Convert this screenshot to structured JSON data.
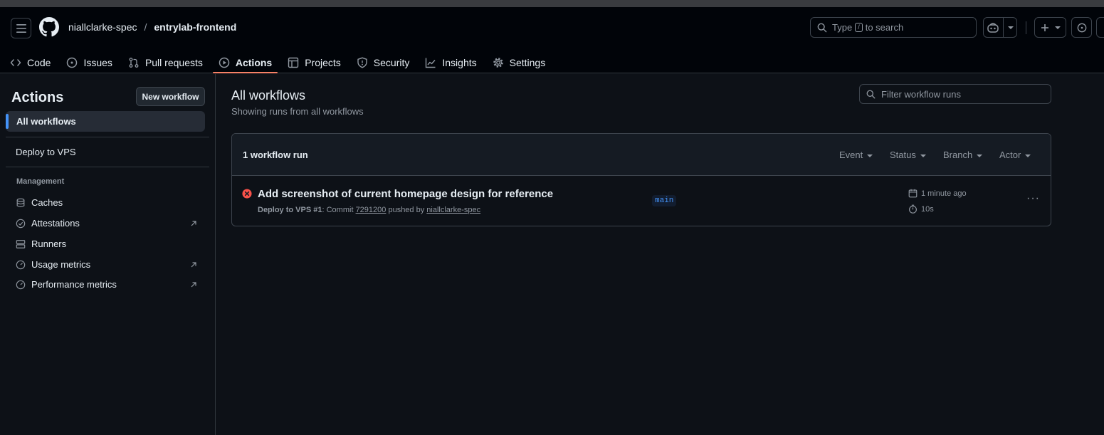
{
  "repo": {
    "owner": "niallclarke-spec",
    "separator": "/",
    "name": "entrylab-frontend"
  },
  "search": {
    "prefix": "Type",
    "key": "/",
    "suffix": "to search"
  },
  "nav": [
    {
      "label": "Code",
      "icon": "code-icon"
    },
    {
      "label": "Issues",
      "icon": "issue-icon"
    },
    {
      "label": "Pull requests",
      "icon": "pull-request-icon"
    },
    {
      "label": "Actions",
      "icon": "play-icon",
      "active": true
    },
    {
      "label": "Projects",
      "icon": "table-icon"
    },
    {
      "label": "Security",
      "icon": "shield-icon"
    },
    {
      "label": "Insights",
      "icon": "graph-icon"
    },
    {
      "label": "Settings",
      "icon": "gear-icon"
    }
  ],
  "sidebar": {
    "title": "Actions",
    "new_workflow": "New workflow",
    "all_workflows": "All workflows",
    "workflows": [
      "Deploy to VPS"
    ],
    "management_heading": "Management",
    "management": [
      {
        "label": "Caches",
        "icon": "database-icon",
        "external": false
      },
      {
        "label": "Attestations",
        "icon": "check-circle-icon",
        "external": true
      },
      {
        "label": "Runners",
        "icon": "server-icon",
        "external": false
      },
      {
        "label": "Usage metrics",
        "icon": "meter-icon",
        "external": true
      },
      {
        "label": "Performance metrics",
        "icon": "meter-icon",
        "external": true
      }
    ]
  },
  "main": {
    "title": "All workflows",
    "subtitle": "Showing runs from all workflows",
    "filter_placeholder": "Filter workflow runs",
    "run_count": "1 workflow run",
    "filters": [
      "Event",
      "Status",
      "Branch",
      "Actor"
    ],
    "runs": [
      {
        "title": "Add screenshot of current homepage design for reference",
        "workflow": "Deploy to VPS #1",
        "commit_label": "Commit",
        "commit": "7291200",
        "pushed_by_label": "pushed by",
        "actor": "niallclarke-spec",
        "branch": "main",
        "time": "1 minute ago",
        "duration": "10s",
        "status": "failure"
      }
    ]
  },
  "colors": {
    "accent": "#f78166",
    "link": "#4493f8",
    "failure": "#f85149"
  }
}
